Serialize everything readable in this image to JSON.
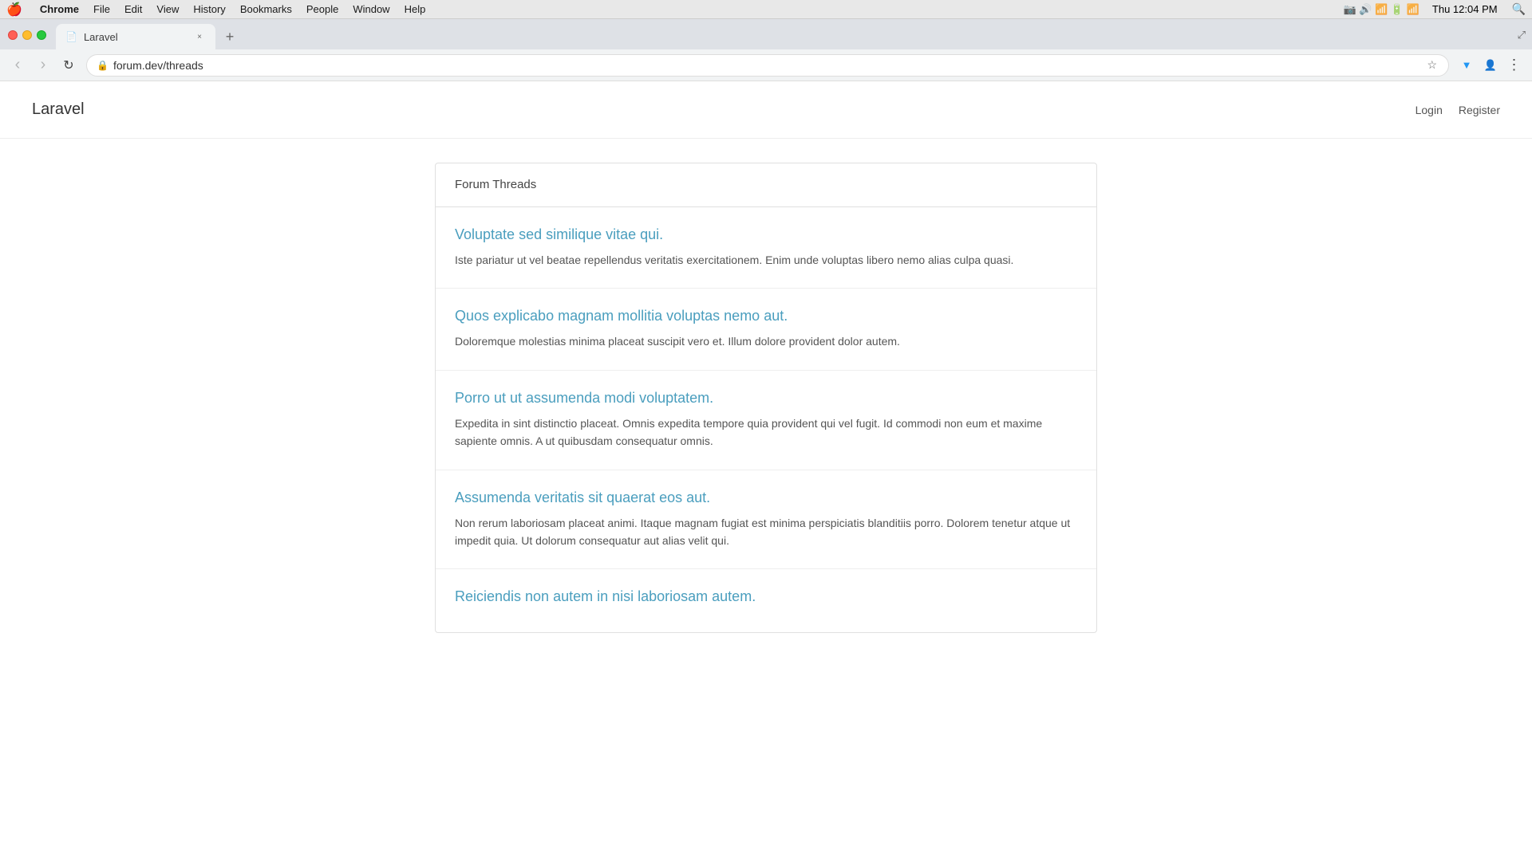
{
  "menubar": {
    "apple": "🍎",
    "items": [
      "Chrome",
      "File",
      "Edit",
      "View",
      "History",
      "Bookmarks",
      "People",
      "Window",
      "Help"
    ],
    "time": "Thu 12:04 PM"
  },
  "browser": {
    "tab": {
      "favicon": "📄",
      "title": "Laravel",
      "close": "×"
    },
    "new_tab_label": "+",
    "toolbar": {
      "back_label": "‹",
      "forward_label": "›",
      "refresh_label": "↻",
      "url_lock": "🔒",
      "url": "forum.dev/threads",
      "url_domain": "forum.dev",
      "url_path": "/threads",
      "bookmark_label": "☆",
      "more_label": "⋮"
    }
  },
  "app": {
    "logo": "Laravel",
    "nav": {
      "login": "Login",
      "register": "Register"
    }
  },
  "forum": {
    "heading": "Forum Threads",
    "threads": [
      {
        "title": "Voluptate sed similique vitae qui.",
        "body": "Iste pariatur ut vel beatae repellendus veritatis exercitationem. Enim unde voluptas libero nemo alias culpa quasi."
      },
      {
        "title": "Quos explicabo magnam mollitia voluptas nemo aut.",
        "body": "Doloremque molestias minima placeat suscipit vero et. Illum dolore provident dolor autem."
      },
      {
        "title": "Porro ut ut assumenda modi voluptatem.",
        "body": "Expedita in sint distinctio placeat. Omnis expedita tempore quia provident qui vel fugit. Id commodi non eum et maxime sapiente omnis. A ut quibusdam consequatur omnis."
      },
      {
        "title": "Assumenda veritatis sit quaerat eos aut.",
        "body": "Non rerum laboriosam placeat animi. Itaque magnam fugiat est minima perspiciatis blanditiis porro. Dolorem tenetur atque ut impedit quia. Ut dolorum consequatur aut alias velit qui."
      },
      {
        "title": "Reiciendis non autem in nisi laboriosam autem.",
        "body": ""
      }
    ]
  },
  "colors": {
    "thread_link": "#4a9ebe",
    "thread_body": "#555555"
  }
}
